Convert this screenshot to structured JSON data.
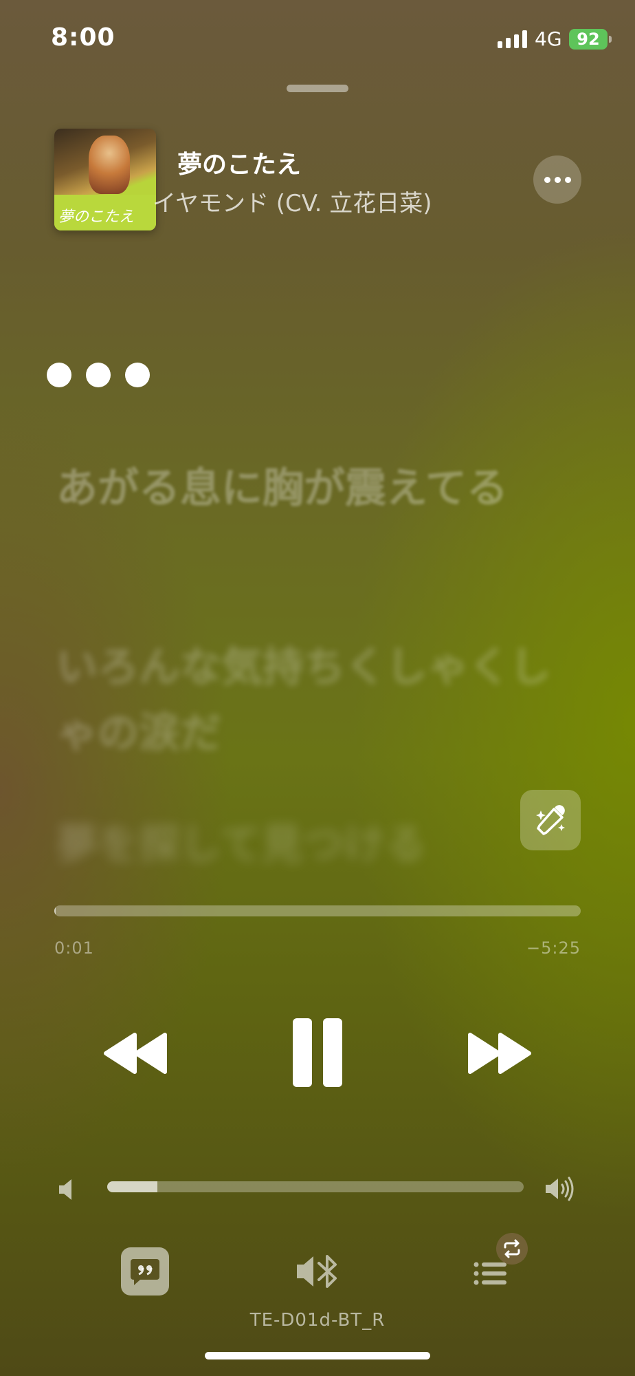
{
  "status_bar": {
    "time": "8:00",
    "network": "4G",
    "battery": "92"
  },
  "now_playing": {
    "title": "夢のこたえ",
    "artist": "イヤモンド (CV. 立花日菜)",
    "artwork_text": "夢のこたえ",
    "more_icon": "ellipsis-icon"
  },
  "lyrics": {
    "lines": [
      "あがる息に胸が震えてる",
      "いろんな気持ちくしゃくしゃの涙だ",
      "夢を探して見つける"
    ]
  },
  "playback": {
    "elapsed": "0:01",
    "remaining": "−5:25",
    "progress_fraction": 0.003,
    "volume_fraction": 0.12
  },
  "output_device": "TE-D01d-BT_R",
  "icons": {
    "sing": "microphone-sparkle-icon",
    "rewind": "rewind-icon",
    "pause": "pause-icon",
    "forward": "fast-forward-icon",
    "volume_low": "speaker-low-icon",
    "volume_high": "speaker-high-icon",
    "lyrics": "lyrics-quote-icon",
    "airplay": "bluetooth-speaker-icon",
    "queue": "queue-list-icon",
    "repeat": "repeat-icon"
  }
}
